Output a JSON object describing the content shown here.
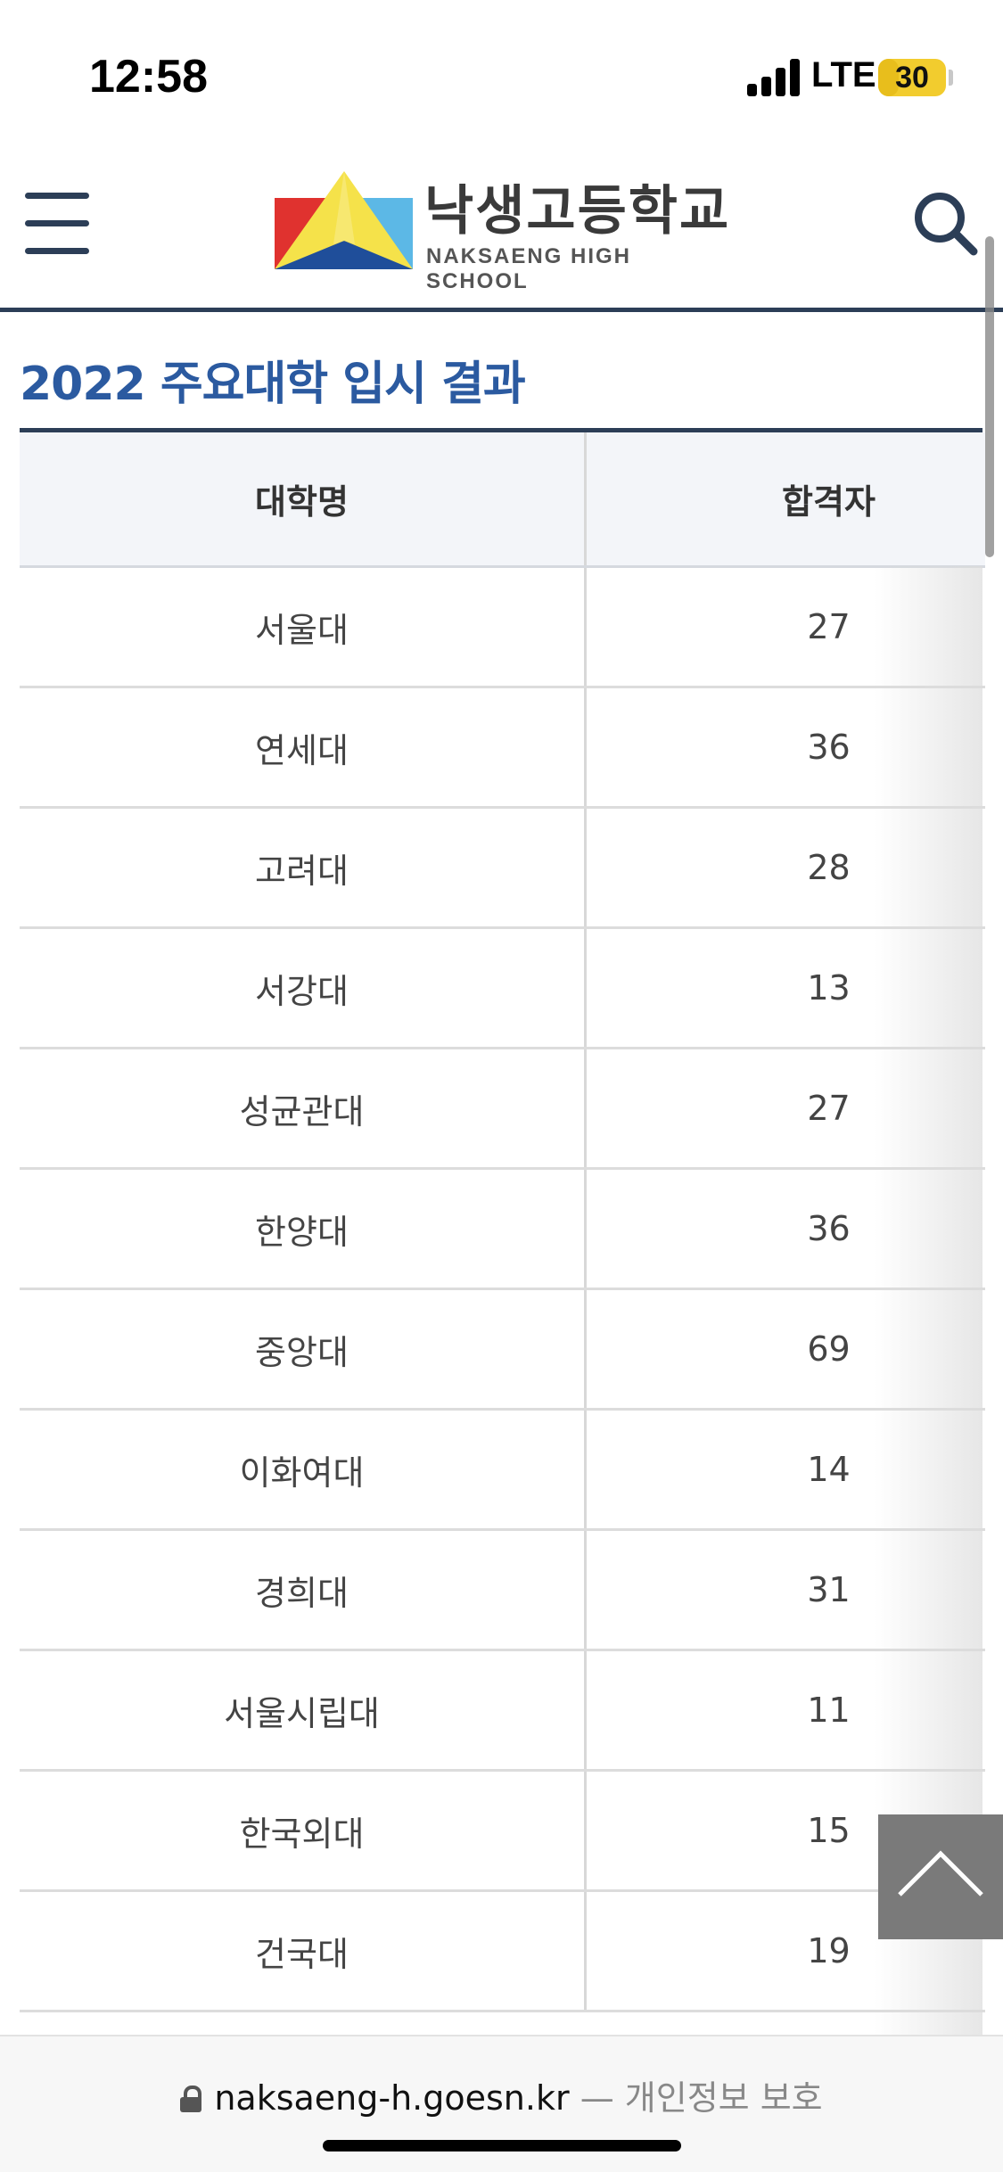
{
  "status_bar": {
    "time": "12:58",
    "network": "LTE",
    "battery": "30",
    "battery_level_percent": 30,
    "battery_color": "#f2cc2e"
  },
  "header": {
    "menu_icon": "hamburger-icon",
    "logo_title": "낙생고등학교",
    "logo_subtitle": "NAKSAENG HIGH SCHOOL",
    "search_icon": "search-icon",
    "rule_color": "#2c3e57"
  },
  "content": {
    "title": "2022 주요대학 입시 결과",
    "title_color": "#2b5aa0",
    "table": {
      "headers": [
        "대학명",
        "합격자"
      ],
      "rows": [
        {
          "university": "서울대",
          "count": "27"
        },
        {
          "university": "연세대",
          "count": "36"
        },
        {
          "university": "고려대",
          "count": "28"
        },
        {
          "university": "서강대",
          "count": "13"
        },
        {
          "university": "성균관대",
          "count": "27"
        },
        {
          "university": "한양대",
          "count": "36"
        },
        {
          "university": "중앙대",
          "count": "69"
        },
        {
          "university": "이화여대",
          "count": "14"
        },
        {
          "university": "경희대",
          "count": "31"
        },
        {
          "university": "서울시립대",
          "count": "11"
        },
        {
          "university": "한국외대",
          "count": "15"
        },
        {
          "university": "건국대",
          "count": "19"
        }
      ]
    }
  },
  "scroll_top_button": {
    "icon": "chevron-up-icon"
  },
  "url_bar": {
    "lock_icon": "lock-icon",
    "domain": "naksaeng-h.goesn.kr",
    "separator": "—",
    "privacy_label": "개인정보 보호"
  }
}
